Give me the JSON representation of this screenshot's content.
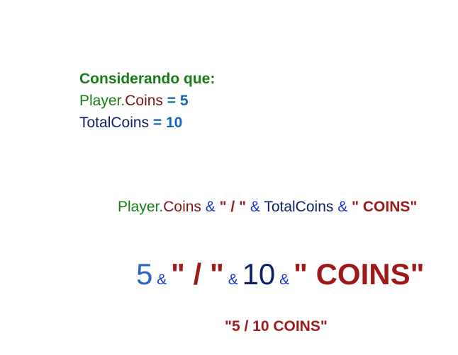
{
  "colors": {
    "green": "#1a7a1a",
    "maroon": "#7a1414",
    "navy": "#0d1f66",
    "blue_bold": "#1267b3",
    "blue_light": "#2a64c8",
    "amp_blue": "#1a33cc",
    "red": "#9e1a1a"
  },
  "given": {
    "heading": "Considerando que:",
    "line1": {
      "player": "Player",
      "dot": ".",
      "coins": "Coins",
      "eq": " = ",
      "value": "5"
    },
    "line2": {
      "total": "TotalCoins",
      "eq": " = ",
      "value": "10"
    }
  },
  "expression": {
    "player": "Player",
    "dot": ".",
    "coins": "Coins",
    "amp1": " & ",
    "slash": "\" / \"",
    "amp2": " & ",
    "total": "TotalCoins",
    "amp3": " & ",
    "quote_open": "\" ",
    "coins_word": "COINS",
    "quote_close": "\""
  },
  "substituted": {
    "v1": "5",
    "amp1": " & ",
    "slash": "\" / \"",
    "amp2": " & ",
    "v2": "10",
    "amp3": " & ",
    "coins_lit": "\" COINS\""
  },
  "result": "\"5 / 10 COINS\""
}
